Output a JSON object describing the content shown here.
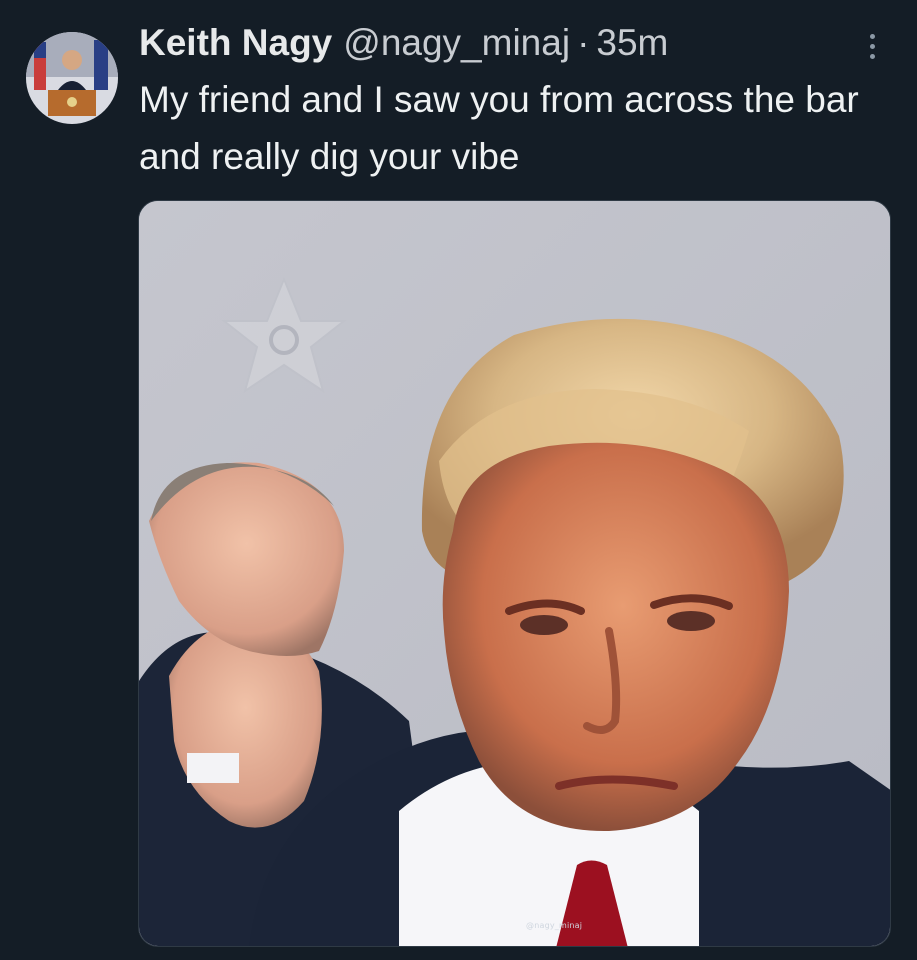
{
  "tweet": {
    "author": {
      "display_name": "Keith Nagy",
      "handle": "@nagy_minaj",
      "avatar": "profile-avatar"
    },
    "separator": "·",
    "timestamp": "35m",
    "text": "My friend and I saw you from across the bar and really dig your vibe",
    "more_icon": "more-options-icon",
    "media": {
      "type": "photo",
      "watermark": "@nagy_minaj"
    }
  },
  "colors": {
    "background": "#141d26",
    "text": "#e7e9ea",
    "muted": "#c8ccd1",
    "photo_wall": "#c9c9cf"
  }
}
